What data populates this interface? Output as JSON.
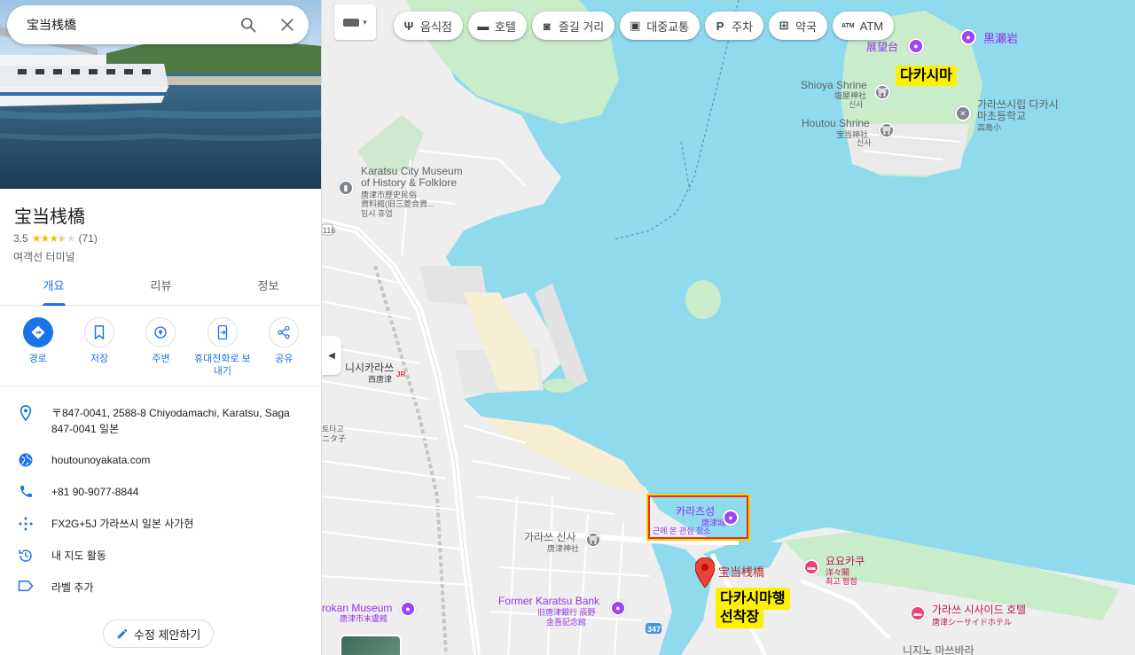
{
  "search": {
    "value": "宝当桟橋"
  },
  "place": {
    "title": "宝当桟橋",
    "rating": "3.5",
    "reviews": "(71)",
    "rating_value": 3.5,
    "category": "여객선 터미널"
  },
  "tabs": [
    {
      "label": "개요",
      "active": true
    },
    {
      "label": "리뷰",
      "active": false
    },
    {
      "label": "정보",
      "active": false
    }
  ],
  "actions": [
    {
      "label": "경로",
      "icon": "directions-icon"
    },
    {
      "label": "저장",
      "icon": "bookmark-icon"
    },
    {
      "label": "주변",
      "icon": "nearby-icon"
    },
    {
      "label": "휴대전화로 보내기",
      "icon": "send-to-phone-icon"
    },
    {
      "label": "공유",
      "icon": "share-icon"
    }
  ],
  "info": {
    "address": "〒847-0041, 2588-8 Chiyodamachi, Karatsu, Saga 847-0041 일본",
    "website": "houtounoyakata.com",
    "phone": "+81 90-9077-8844",
    "plus_code": "FX2G+5J 가라쓰시 일본 사가현",
    "activity": "내 지도 활동",
    "label": "라벨 추가"
  },
  "edit_button": "수정 제안하기",
  "map": {
    "chips": [
      {
        "label": "음식점",
        "icon": "restaurant-icon",
        "glyph": "Ψ"
      },
      {
        "label": "호텔",
        "icon": "hotel-icon",
        "glyph": "▬"
      },
      {
        "label": "즐길 거리",
        "icon": "camera-icon",
        "glyph": "◙"
      },
      {
        "label": "대중교통",
        "icon": "transit-icon",
        "glyph": "▣"
      },
      {
        "label": "주차",
        "icon": "parking-icon",
        "glyph": "P"
      },
      {
        "label": "약국",
        "icon": "pharmacy-icon",
        "glyph": "⊞"
      },
      {
        "label": "ATM",
        "icon": "atm-icon",
        "glyph": "ATM"
      }
    ],
    "labels": {
      "tenbodai": "展望台",
      "kurosegan": "黒瀬岩",
      "takashima_tag": "다카시마",
      "shioya": "Shioya Shrine",
      "shioya_jp": "塩屋神社",
      "shioya_kr": "신사",
      "school_kr1": "가라쓰시립 다카시",
      "school_kr2": "마초등학교",
      "school_jp": "高島小",
      "houtou": "Houtou Shrine",
      "houtou_jp": "宝当神社",
      "houtou_kr": "신사",
      "museum1": "Karatsu City Museum",
      "museum2": "of History & Folklore",
      "museum_jp1": "唐津市歴史民俗",
      "museum_jp2": "資料館(旧三菱合資...",
      "museum_kr": "임시 휴업",
      "route_num": "116",
      "nishikaratsu": "니시카라쓰",
      "nishikaratsu_jp": "西唐津",
      "jr": "JR",
      "tata1": "토타고",
      "tata2": "ニタ子",
      "karatsu_castle": "카라츠성",
      "karatsu_castle_jp": "唐津城",
      "karatsu_castle_sub": "근에 본 관심 장소",
      "karatsu_shrine": "가라쓰 신사",
      "karatsu_shrine_jp": "唐津神社",
      "pier": "宝当桟橋",
      "pier_tag1": "다카시마행",
      "pier_tag2": "선착장",
      "yoyokaku": "요요카쿠",
      "yoyokaku_jp": "洋々閣",
      "yoyokaku_sub": "최고 평점",
      "seaside": "가라쓰 시사이드 호텔",
      "seaside_jp": "唐津シーサイドホテル",
      "bank1": "Former Karatsu Bank",
      "bank2": "旧唐津銀行 辰野",
      "bank3": "金吾記念館",
      "mukan1": "rokan Museum",
      "mukan2": "唐津市末盧館",
      "route347": "347",
      "nijino": "니지노 마쓰바라"
    }
  }
}
